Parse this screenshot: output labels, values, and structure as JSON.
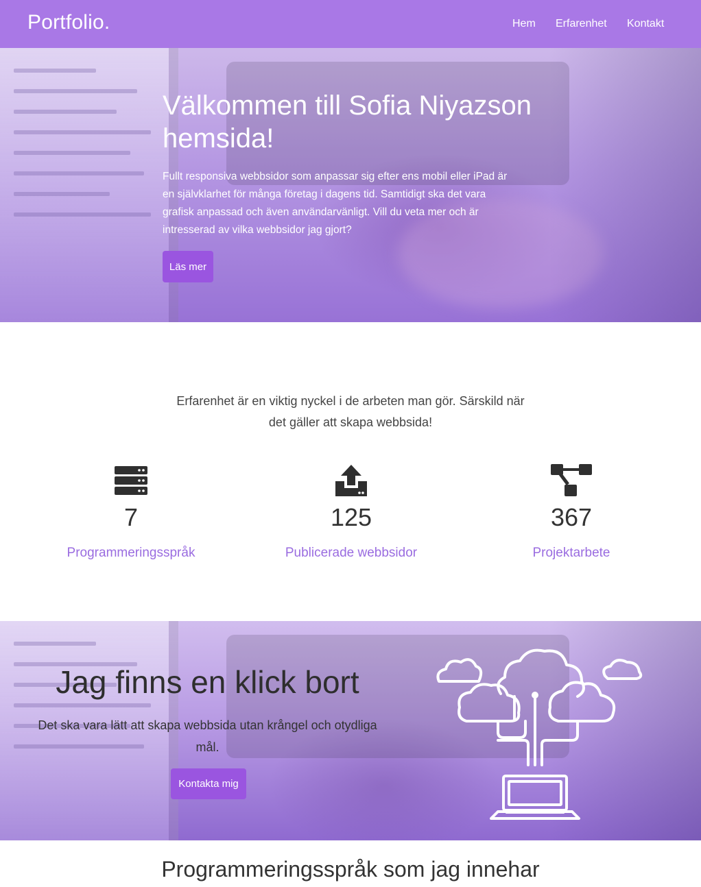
{
  "navbar": {
    "brand": "Portfolio.",
    "links": [
      "Hem",
      "Erfarenhet",
      "Kontakt"
    ]
  },
  "hero": {
    "title": "Välkommen till Sofia Niyazson hemsida!",
    "text": "Fullt responsiva webbsidor som anpassar sig efter ens mobil eller iPad är en självklarhet för många företag i dagens tid. Samtidigt ska det vara grafisk anpassad och även användarvänligt. Vill du veta mer och är intresserad av vilka webbsidor jag gjort?",
    "button": "Läs mer"
  },
  "experience": {
    "intro": "Erfarenhet är en viktig nyckel i de arbeten man gör. Särskild när det gäller att skapa webbsida!",
    "stats": [
      {
        "icon": "server-icon",
        "number": "7",
        "label": "Programmeringsspråk"
      },
      {
        "icon": "upload-icon",
        "number": "125",
        "label": "Publicerade webbsidor"
      },
      {
        "icon": "sitemap-icon",
        "number": "367",
        "label": "Projektarbete"
      }
    ]
  },
  "contact_banner": {
    "title": "Jag finns en klick bort",
    "text": "Det ska vara lätt att skapa webbsida utan krångel och otydliga mål.",
    "button": "Kontakta mig",
    "illustration": "cloud-network-laptop-icon"
  },
  "skills": {
    "title": "Programmeringsspråk som jag innehar"
  },
  "colors": {
    "accent": "#a978e6",
    "button": "#9a55e0",
    "label": "#9a6ce0"
  }
}
